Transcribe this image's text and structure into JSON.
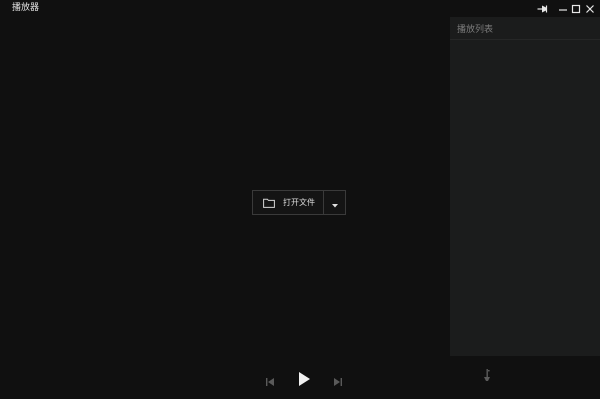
{
  "window": {
    "title": "播放器",
    "controls": [
      "pin-icon",
      "minimize-icon",
      "maximize-icon",
      "close-icon"
    ]
  },
  "playlist": {
    "title": "播放列表",
    "items": []
  },
  "open_file": {
    "label": "打开文件",
    "icon": "folder-icon",
    "dropdown_icon": "caret-down-icon"
  },
  "controls": {
    "prev_icon": "skip-previous-icon",
    "play_icon": "play-icon",
    "next_icon": "skip-next-icon",
    "side_icon": "playlist-toggle-icon"
  },
  "colors": {
    "background": "#101010",
    "panel": "#1b1c1c",
    "text": "#dcdcdc",
    "muted": "#7c7c7c"
  }
}
